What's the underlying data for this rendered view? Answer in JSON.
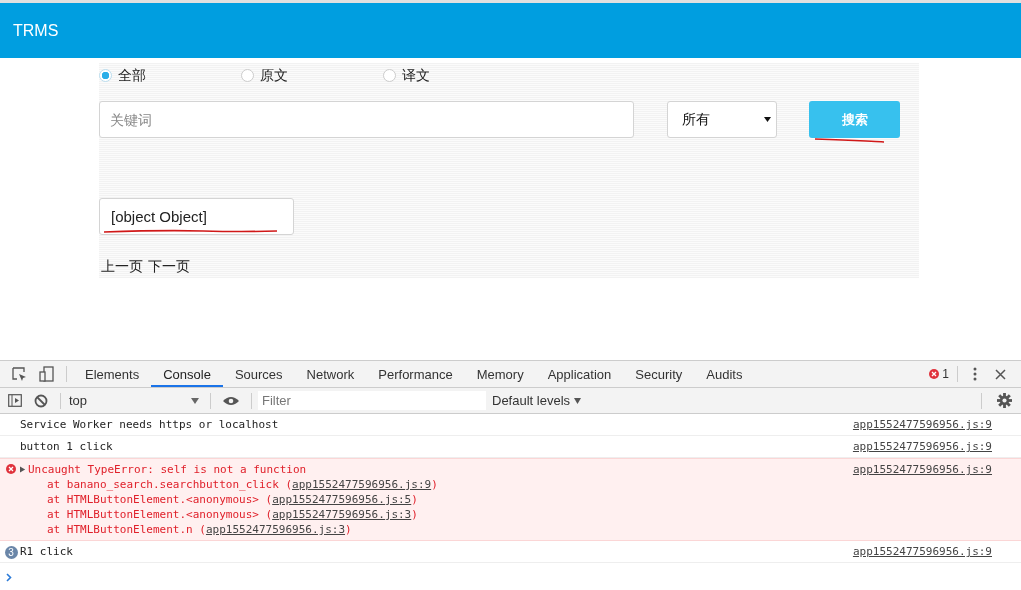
{
  "header": {
    "title": "TRMS"
  },
  "radios": [
    {
      "label": "全部",
      "selected": true
    },
    {
      "label": "原文",
      "selected": false
    },
    {
      "label": "译文",
      "selected": false
    }
  ],
  "search": {
    "placeholder": "关键词",
    "select_value": "所有",
    "button": "搜索"
  },
  "result": {
    "value": "[object Object]"
  },
  "pager": [
    "上一页",
    "下一页"
  ],
  "devtools": {
    "tabs": [
      {
        "label": "Elements",
        "selected": false
      },
      {
        "label": "Console",
        "selected": true
      },
      {
        "label": "Sources",
        "selected": false
      },
      {
        "label": "Network",
        "selected": false
      },
      {
        "label": "Performance",
        "selected": false
      },
      {
        "label": "Memory",
        "selected": false
      },
      {
        "label": "Application",
        "selected": false
      },
      {
        "label": "Security",
        "selected": false
      },
      {
        "label": "Audits",
        "selected": false
      }
    ],
    "error_count": "1",
    "context": "top",
    "filter_placeholder": "Filter",
    "levels": "Default levels",
    "messages": [
      {
        "kind": "log",
        "text": "Service Worker needs https or localhost",
        "source": "app1552477596956.js:9"
      },
      {
        "kind": "log",
        "text": "button 1 click",
        "source": "app1552477596956.js:9"
      },
      {
        "kind": "error",
        "expanded": false,
        "text": "Uncaught TypeError: self is not a function",
        "source": "app1552477596956.js:9",
        "stack": [
          {
            "text": "at banano_search.searchbutton_click (",
            "link": "app1552477596956.js:9",
            "close": ")"
          },
          {
            "text": "at HTMLButtonElement.<anonymous> (",
            "link": "app1552477596956.js:5",
            "close": ")"
          },
          {
            "text": "at HTMLButtonElement.<anonymous> (",
            "link": "app1552477596956.js:3",
            "close": ")"
          },
          {
            "text": "at HTMLButtonElement.n (",
            "link": "app1552477596956.js:3",
            "close": ")"
          }
        ]
      },
      {
        "kind": "repeated",
        "count": "3",
        "text": "R1 click",
        "source": "app1552477596956.js:9"
      }
    ]
  }
}
